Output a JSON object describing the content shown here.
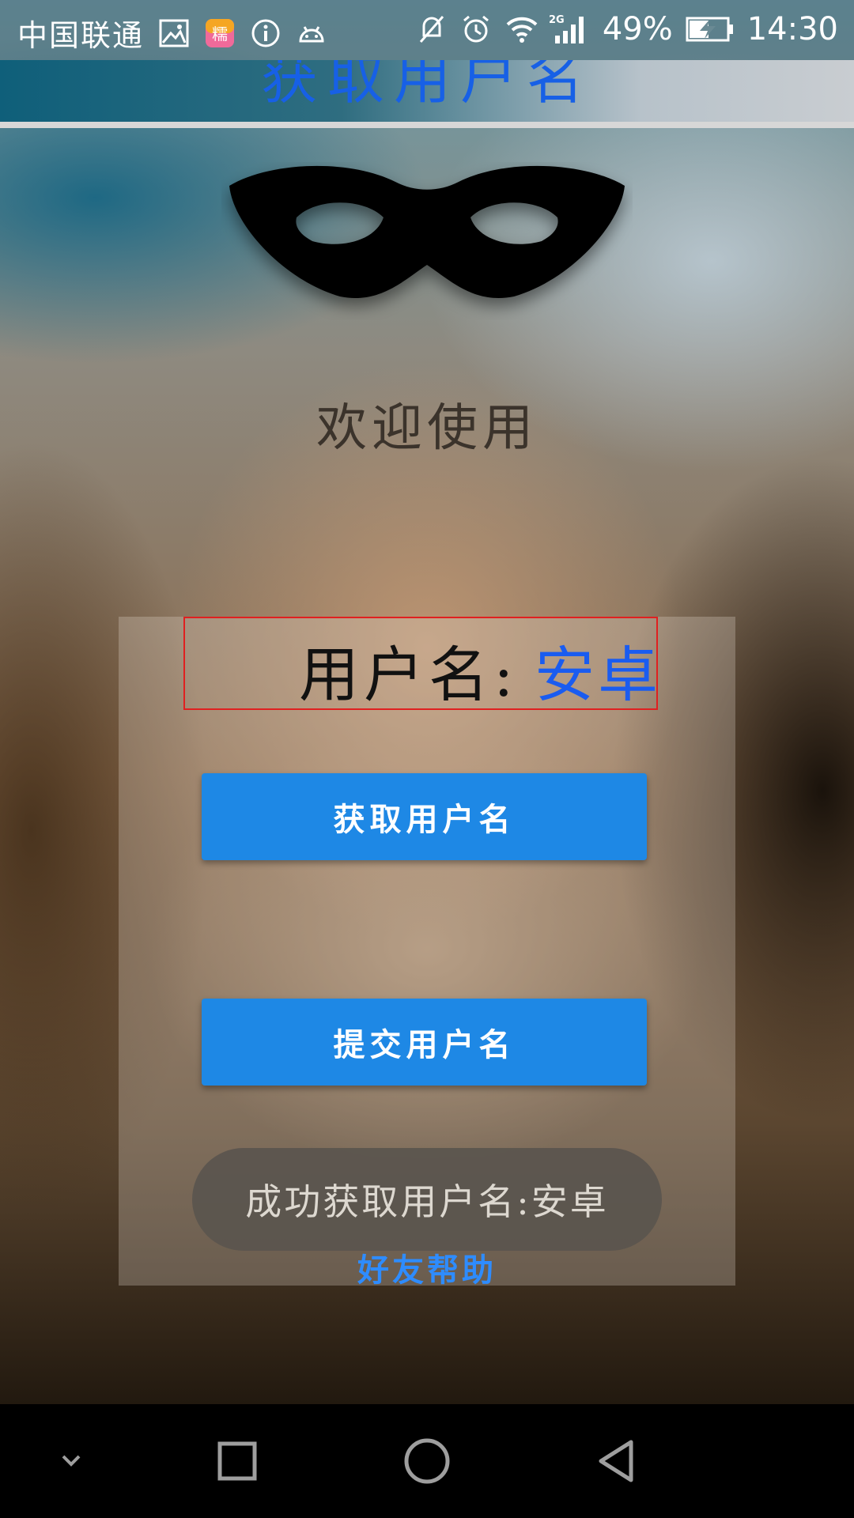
{
  "status_bar": {
    "carrier": "中国联通",
    "network_badge": "2G",
    "battery_percent": "49%",
    "time": "14:30",
    "icons": [
      "gallery-icon",
      "app-icon",
      "info-icon",
      "android-icon",
      "mute-icon",
      "alarm-icon",
      "wifi-icon",
      "signal-icon",
      "battery-charging-icon"
    ],
    "app_icon_text": "糯"
  },
  "header": {
    "title": "获取用户名"
  },
  "welcome": {
    "text": "欢迎使用"
  },
  "form": {
    "username_label": "用户名:",
    "username_value": "安卓",
    "get_button_label": "获取用户名",
    "submit_button_label": "提交用户名",
    "friend_help_link": "好友帮助"
  },
  "toast": {
    "message": "成功获取用户名:安卓"
  },
  "nav_bar": {
    "icons": [
      "hide-keyboard-icon",
      "recents-icon",
      "home-icon",
      "back-icon"
    ]
  },
  "colors": {
    "title": "#1760e6",
    "username_value": "#1a5cf0",
    "button": "#1e88e5",
    "link": "#2e8cff",
    "highlight_border": "#e02020"
  }
}
